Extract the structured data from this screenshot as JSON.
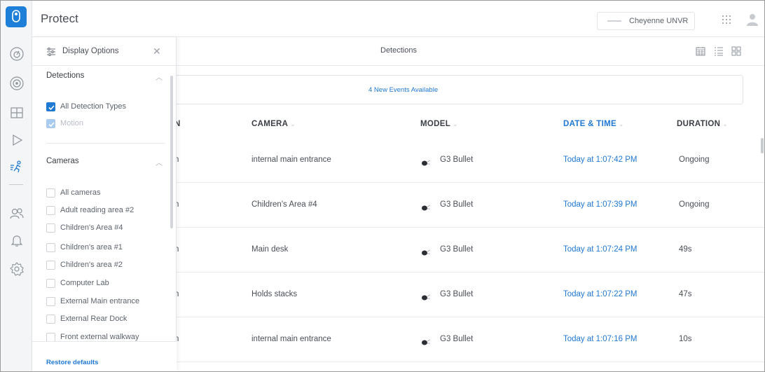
{
  "app": {
    "title": "Protect"
  },
  "nvr": {
    "name": "Cheyenne UNVR",
    "chevron": "⌄"
  },
  "toolbar": {
    "title": "Detections"
  },
  "banner": {
    "text": "4 New Events Available"
  },
  "panel": {
    "title": "Display Options",
    "detections_title": "Detections",
    "detection_items": [
      {
        "label": "All Detection Types",
        "checked": true,
        "disabled": false
      },
      {
        "label": "Motion",
        "checked": true,
        "disabled": true
      }
    ],
    "cameras_title": "Cameras",
    "camera_items": [
      {
        "label": "All cameras"
      },
      {
        "label": "Adult reading area #2"
      },
      {
        "label": "Children's Area #4"
      },
      {
        "label": "Children's area #1"
      },
      {
        "label": "Children's area #2"
      },
      {
        "label": "Computer Lab"
      },
      {
        "label": "External Main entrance"
      },
      {
        "label": "External Rear Dock"
      },
      {
        "label": "Front external walkway"
      }
    ],
    "restore_label": "Restore defaults"
  },
  "table": {
    "columns": [
      {
        "label": "N"
      },
      {
        "label": "CAMERA"
      },
      {
        "label": "MODEL"
      },
      {
        "label": "DATE & TIME"
      },
      {
        "label": "DURATION"
      }
    ],
    "rows": [
      {
        "type": "n",
        "camera": "internal main entrance",
        "model": "G3 Bullet",
        "date": "Today at 1:07:42 PM",
        "duration": "Ongoing"
      },
      {
        "type": "n",
        "camera": "Children's Area #4",
        "model": "G3 Bullet",
        "date": "Today at 1:07:39 PM",
        "duration": "Ongoing"
      },
      {
        "type": "n",
        "camera": "Main desk",
        "model": "G3 Bullet",
        "date": "Today at 1:07:24 PM",
        "duration": "49s"
      },
      {
        "type": "n",
        "camera": "Holds stacks",
        "model": "G3 Bullet",
        "date": "Today at 1:07:22 PM",
        "duration": "47s"
      },
      {
        "type": "n",
        "camera": "internal main entrance",
        "model": "G3 Bullet",
        "date": "Today at 1:07:16 PM",
        "duration": "10s"
      }
    ]
  },
  "colors": {
    "accent": "#1f78d1",
    "logo": "#1e7fd9"
  },
  "icons": {
    "rail": [
      "logo-icon",
      "dashboard-icon",
      "devices-icon",
      "liveview-icon",
      "timelapse-icon",
      "detections-icon",
      "users-icon",
      "alerts-icon",
      "settings-icon"
    ],
    "header": [
      "apps-grid-icon",
      "user-avatar-icon"
    ],
    "views": [
      "calendar-view-icon",
      "list-view-icon",
      "grid-view-icon"
    ]
  }
}
